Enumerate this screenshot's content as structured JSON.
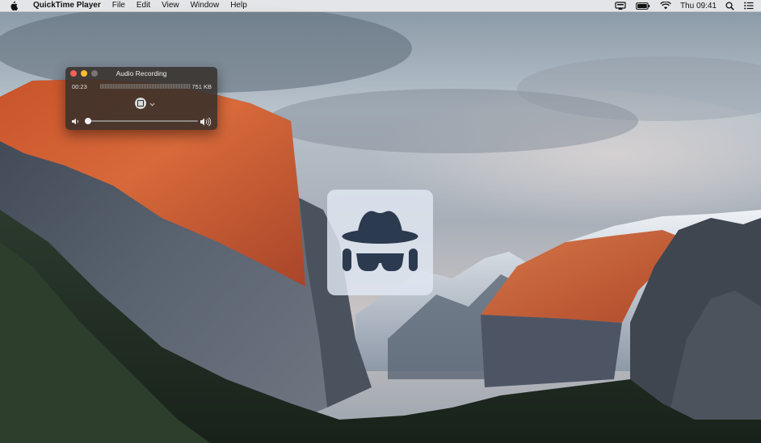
{
  "menubar": {
    "apple_icon": "apple-logo-icon",
    "app_name": "QuickTime Player",
    "menus": [
      "File",
      "Edit",
      "View",
      "Window",
      "Help"
    ],
    "status_icons": [
      "display-mirroring-icon",
      "battery-icon",
      "wifi-icon",
      "spotlight-search-icon",
      "notification-center-icon"
    ],
    "clock": "Thu 09:41"
  },
  "recording_window": {
    "title": "Audio Recording",
    "elapsed": "00:23",
    "file_size": "751 KB",
    "volume_level": 0,
    "icons": [
      "stop-icon",
      "chevron-down-icon",
      "volume-low-icon",
      "volume-high-icon"
    ]
  },
  "hud": {
    "icon": "incognito-icon"
  },
  "colors": {
    "close": "#fc5f57",
    "minimize": "#fdbc2e",
    "zoom_inactive": "#7a7672",
    "hud_icon": "#2c3a4f"
  }
}
